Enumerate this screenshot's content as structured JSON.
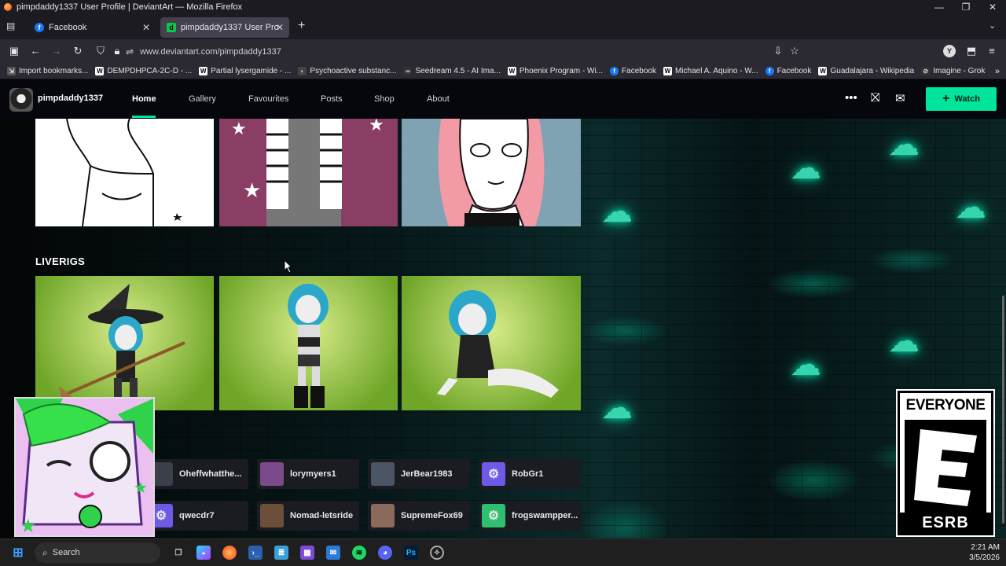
{
  "window": {
    "title": "pimpdaddy1337 User Profile | DeviantArt — Mozilla Firefox",
    "controls": [
      "—",
      "❐",
      "✕"
    ]
  },
  "tabs": [
    {
      "label": "Facebook",
      "icon": "facebook-icon",
      "color": "#1877f2"
    },
    {
      "label": "pimpdaddy1337 User Profile | D",
      "icon": "deviantart-icon",
      "color": "#05cc47"
    }
  ],
  "new_tab_label": "+",
  "url": "www.deviantart.com/pimpdaddy1337",
  "bookmarks": [
    {
      "label": "Import bookmarks...",
      "icon": "import-icon"
    },
    {
      "label": "DEMPDHPCA-2C-D - ...",
      "icon": "wikipedia-icon"
    },
    {
      "label": "Partial lysergamide - ...",
      "icon": "wikipedia-icon"
    },
    {
      "label": "Psychoactive substanc...",
      "icon": "site-icon"
    },
    {
      "label": "Seedream 4.5 - AI Ima...",
      "icon": "site-icon"
    },
    {
      "label": "Phoenix Program - Wi...",
      "icon": "wikipedia-icon"
    },
    {
      "label": "Facebook",
      "icon": "facebook-icon"
    },
    {
      "label": "Michael A. Aquino - W...",
      "icon": "wikipedia-icon"
    },
    {
      "label": "Facebook",
      "icon": "facebook-icon"
    },
    {
      "label": "Guadalajara - Wikipedia",
      "icon": "wikipedia-icon"
    },
    {
      "label": "Imagine - Grok",
      "icon": "grok-icon"
    }
  ],
  "profile": {
    "username": "pimpdaddy1337",
    "nav": [
      "Home",
      "Gallery",
      "Favourites",
      "Posts",
      "Shop",
      "About"
    ],
    "watch_label": "Watch",
    "section_title": "LIVERIGS"
  },
  "watchers": [
    {
      "name": "Oheffwhatthe...",
      "color": "#3a3f4a"
    },
    {
      "name": "lorymyers1",
      "color": "#7a4a8a"
    },
    {
      "name": "JerBear1983",
      "color": "#4b5563"
    },
    {
      "name": "RobGr1",
      "color": "#6d5ae6"
    },
    {
      "name": "qwecdr7",
      "color": "#6d5ae6"
    },
    {
      "name": "Nomad-letsride",
      "color": "#6b4f3a"
    },
    {
      "name": "SupremeFox69",
      "color": "#8a6a5a"
    },
    {
      "name": "frogswampper...",
      "color": "#2fbf71"
    }
  ],
  "esrb": {
    "top": "EVERYONE",
    "letter": "E",
    "bottom": "ESRB"
  },
  "taskbar": {
    "search_placeholder": "Search",
    "time": "2:21 AM",
    "date": "3/5/2026"
  }
}
